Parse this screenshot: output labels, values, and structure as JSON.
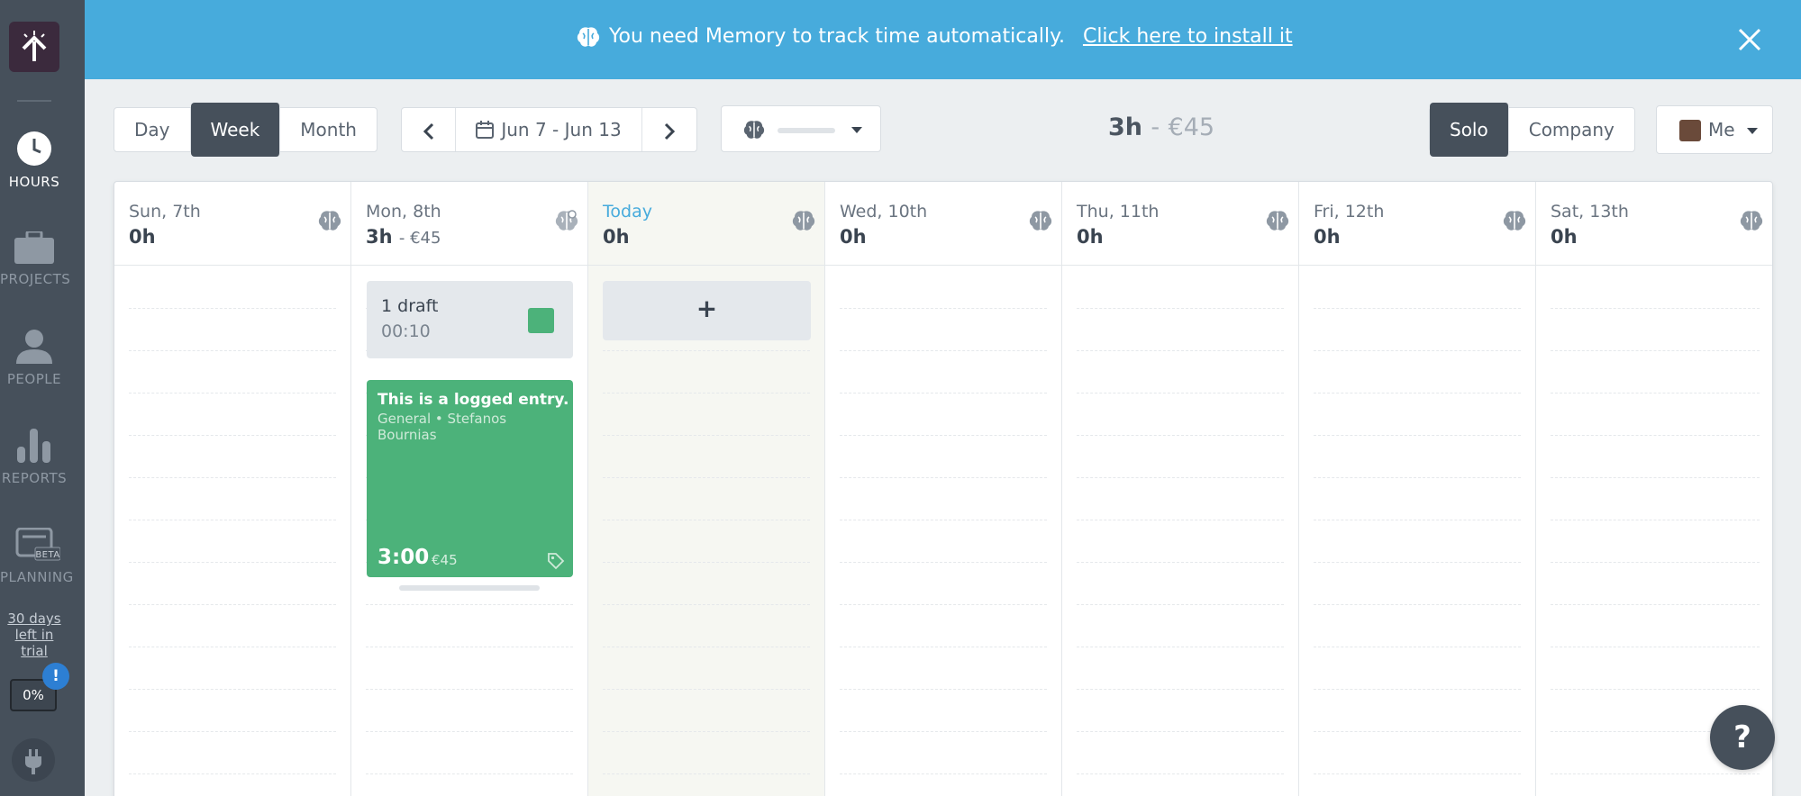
{
  "banner": {
    "message": "You need Memory to track time automatically.",
    "link": "Click here to install it"
  },
  "sidebar": {
    "items": [
      {
        "label": "HOURS"
      },
      {
        "label": "PROJECTS"
      },
      {
        "label": "PEOPLE"
      },
      {
        "label": "REPORTS"
      },
      {
        "label": "PLANNING",
        "badge": "BETA"
      }
    ],
    "trial_line1": "30 days",
    "trial_line2": "left in trial",
    "progress": "0%",
    "notice": "!"
  },
  "toolbar": {
    "view_tabs": [
      "Day",
      "Week",
      "Month"
    ],
    "active_view": "Week",
    "date_range": "Jun 7 - Jun 13",
    "total_hours": "3h",
    "total_separator": "-",
    "total_money": "€45",
    "scope_tabs": [
      "Solo",
      "Company"
    ],
    "active_scope": "Solo",
    "user_label": "Me"
  },
  "days": [
    {
      "name": "Sun, 7th",
      "total": "0h"
    },
    {
      "name": "Mon, 8th",
      "total": "3h",
      "money": "- €45"
    },
    {
      "name": "Today",
      "total": "0h"
    },
    {
      "name": "Wed, 10th",
      "total": "0h"
    },
    {
      "name": "Thu, 11th",
      "total": "0h"
    },
    {
      "name": "Fri, 12th",
      "total": "0h"
    },
    {
      "name": "Sat, 13th",
      "total": "0h"
    }
  ],
  "draft": {
    "label": "1 draft",
    "duration": "00:10"
  },
  "entry": {
    "title": "This is a logged entry.",
    "meta": "General • Stefanos Bournias",
    "duration": "3:00",
    "money": "€45"
  },
  "add_label": "+",
  "help_label": "?",
  "colors": {
    "banner": "#47abdc",
    "sidebar": "#46505b",
    "entry": "#4cb27a",
    "today_accent": "#47abdc"
  }
}
